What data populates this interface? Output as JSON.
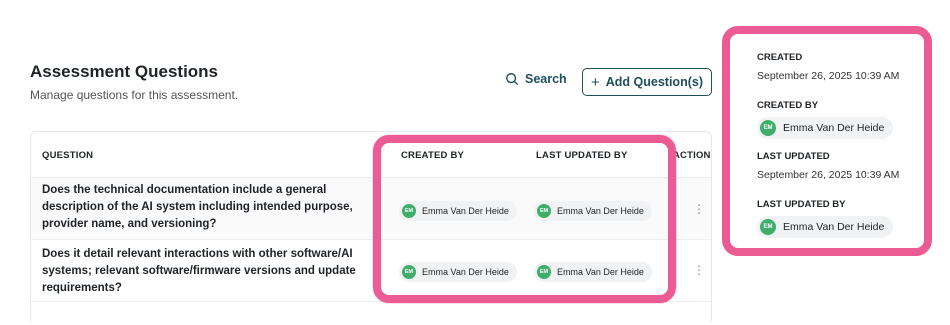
{
  "header": {
    "title": "Assessment Questions",
    "subtitle": "Manage questions for this assessment.",
    "search_label": "Search",
    "add_plus": "+",
    "add_label": "Add Question(s)"
  },
  "table": {
    "columns": {
      "question": "QUESTION",
      "created_by": "CREATED BY",
      "last_updated_by": "LAST UPDATED BY",
      "actions": "ACTIONS"
    },
    "rows": [
      {
        "question": "Does the technical documentation include a general description of the AI system including intended purpose, provider name, and versioning?",
        "created_by": {
          "initials": "EM",
          "name": "Emma Van Der Heide"
        },
        "last_updated_by": {
          "initials": "EM",
          "name": "Emma Van Der Heide"
        },
        "action_icon": "⋮"
      },
      {
        "question": "Does it detail relevant interactions with other software/AI systems; relevant software/firmware versions and update requirements?",
        "created_by": {
          "initials": "EM",
          "name": "Emma Van Der Heide"
        },
        "last_updated_by": {
          "initials": "EM",
          "name": "Emma Van Der Heide"
        },
        "action_icon": "⋮"
      }
    ]
  },
  "detail_panel": {
    "created_label": "CREATED",
    "created_value": "September 26, 2025 10:39 AM",
    "created_by_label": "CREATED BY",
    "created_by": {
      "initials": "EM",
      "name": "Emma Van Der Heide"
    },
    "last_updated_label": "LAST UPDATED",
    "last_updated_value": "September 26, 2025 10:39 AM",
    "last_updated_by_label": "LAST UPDATED BY",
    "last_updated_by": {
      "initials": "EM",
      "name": "Emma Van Der Heide"
    }
  },
  "colors": {
    "accent": "#1f4e5f",
    "highlight": "#ec5c94",
    "avatar": "#3fae6a"
  },
  "icons": {
    "search": "search-icon",
    "actions": "kebab-icon"
  }
}
